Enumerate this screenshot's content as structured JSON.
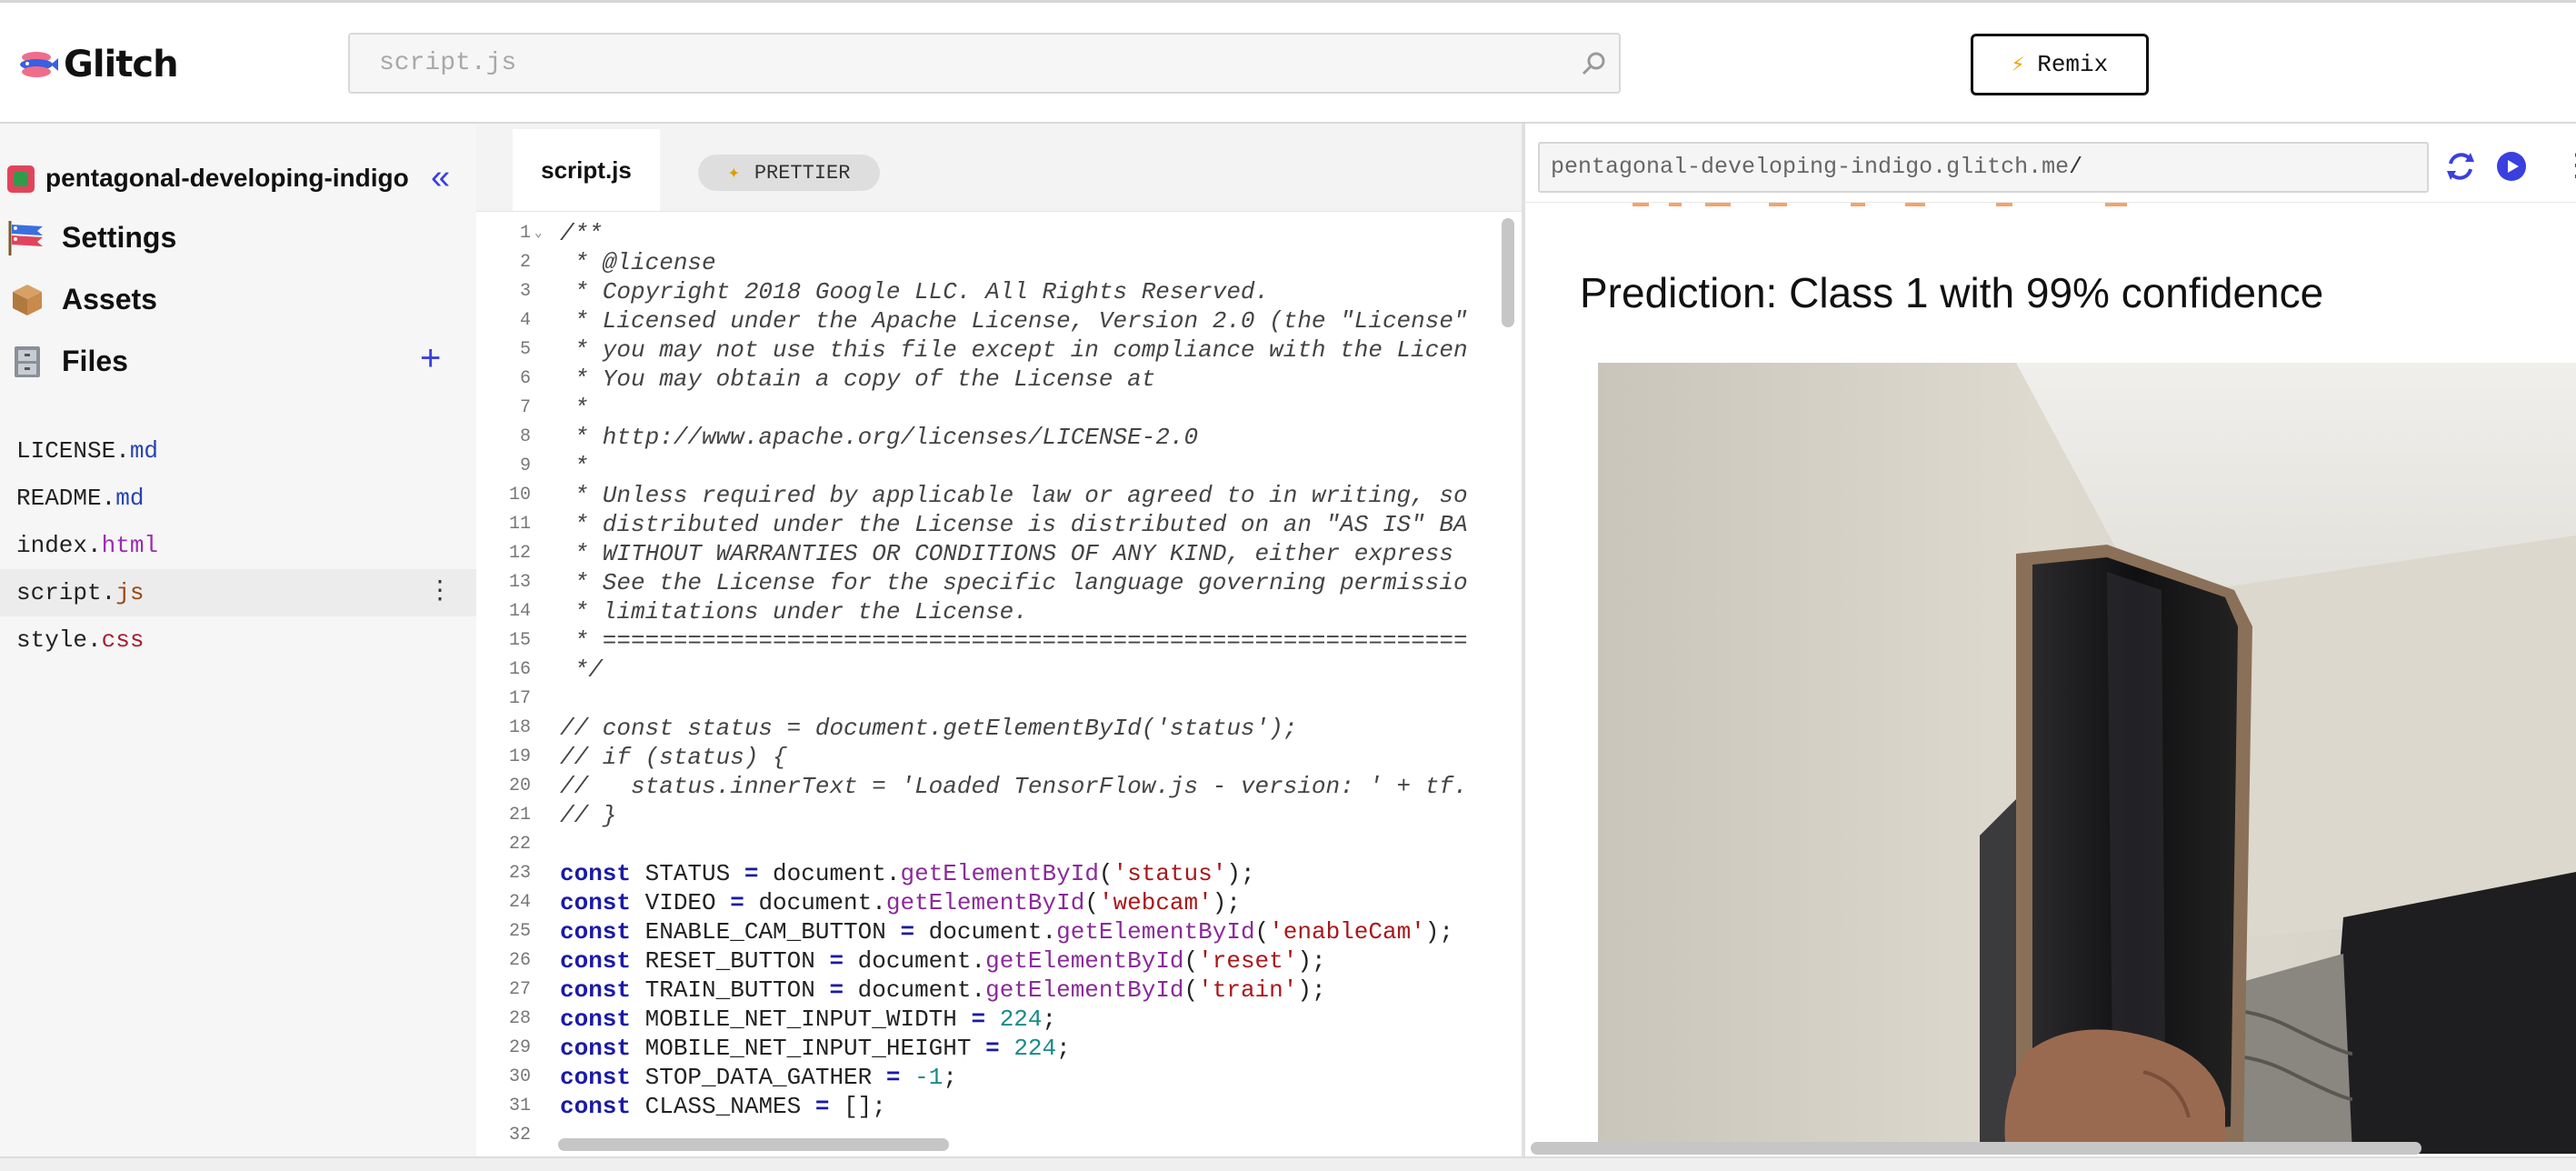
{
  "app": {
    "brand": "Glitch"
  },
  "header": {
    "search_placeholder": "script.js",
    "remix_label": "Remix"
  },
  "sidebar": {
    "project_name": "pentagonal-developing-indigo",
    "nav": [
      {
        "label": "Settings",
        "icon": "carp-streamer-icon"
      },
      {
        "label": "Assets",
        "icon": "box-icon"
      },
      {
        "label": "Files",
        "icon": "file-cabinet-icon"
      }
    ],
    "files": [
      {
        "base": "LICENSE.",
        "ext": "md"
      },
      {
        "base": "README.",
        "ext": "md"
      },
      {
        "base": "index.",
        "ext": "html"
      },
      {
        "base": "script.",
        "ext": "js"
      },
      {
        "base": "style.",
        "ext": "css"
      }
    ]
  },
  "editor": {
    "active_tab": "script.js",
    "prettier_label": "PRETTIER",
    "line_numbers": [
      "1",
      "2",
      "3",
      "4",
      "5",
      "6",
      "7",
      "8",
      "9",
      "10",
      "11",
      "12",
      "13",
      "14",
      "15",
      "16",
      "17",
      "18",
      "19",
      "20",
      "21",
      "22",
      "23",
      "24",
      "25",
      "26",
      "27",
      "28",
      "29",
      "30",
      "31",
      "32"
    ],
    "lines": [
      "/**",
      " * @license",
      " * Copyright 2018 Google LLC. All Rights Reserved.",
      " * Licensed under the Apache License, Version 2.0 (the \"License\"",
      " * you may not use this file except in compliance with the Licen",
      " * You may obtain a copy of the License at",
      " *",
      " * http://www.apache.org/licenses/LICENSE-2.0",
      " *",
      " * Unless required by applicable law or agreed to in writing, so",
      " * distributed under the License is distributed on an \"AS IS\" BA",
      " * WITHOUT WARRANTIES OR CONDITIONS OF ANY KIND, either express ",
      " * See the License for the specific language governing permissio",
      " * limitations under the License.",
      " * =============================================================",
      " */",
      "",
      "// const status = document.getElementById('status');",
      "// if (status) {",
      "//   status.innerText = 'Loaded TensorFlow.js - version: ' + tf.",
      "// }",
      "",
      "const STATUS = document.getElementById('status');",
      "const VIDEO = document.getElementById('webcam');",
      "const ENABLE_CAM_BUTTON = document.getElementById('enableCam');",
      "const RESET_BUTTON = document.getElementById('reset');",
      "const TRAIN_BUTTON = document.getElementById('train');",
      "const MOBILE_NET_INPUT_WIDTH = 224;",
      "const MOBILE_NET_INPUT_HEIGHT = 224;",
      "const STOP_DATA_GATHER = -1;",
      "const CLASS_NAMES = [];",
      ""
    ]
  },
  "preview": {
    "url": "pentagonal-developing-indigo.glitch.me",
    "url_path": "/",
    "prediction_text": "Prediction: Class 1 with 99% confidence"
  },
  "colors": {
    "accent": "#3a3fe0",
    "remix_bolt": "#f2a300",
    "keyword": "#1a1aa8",
    "string": "#a8171a",
    "function": "#8a2a9a",
    "number": "#1a8a8a"
  }
}
